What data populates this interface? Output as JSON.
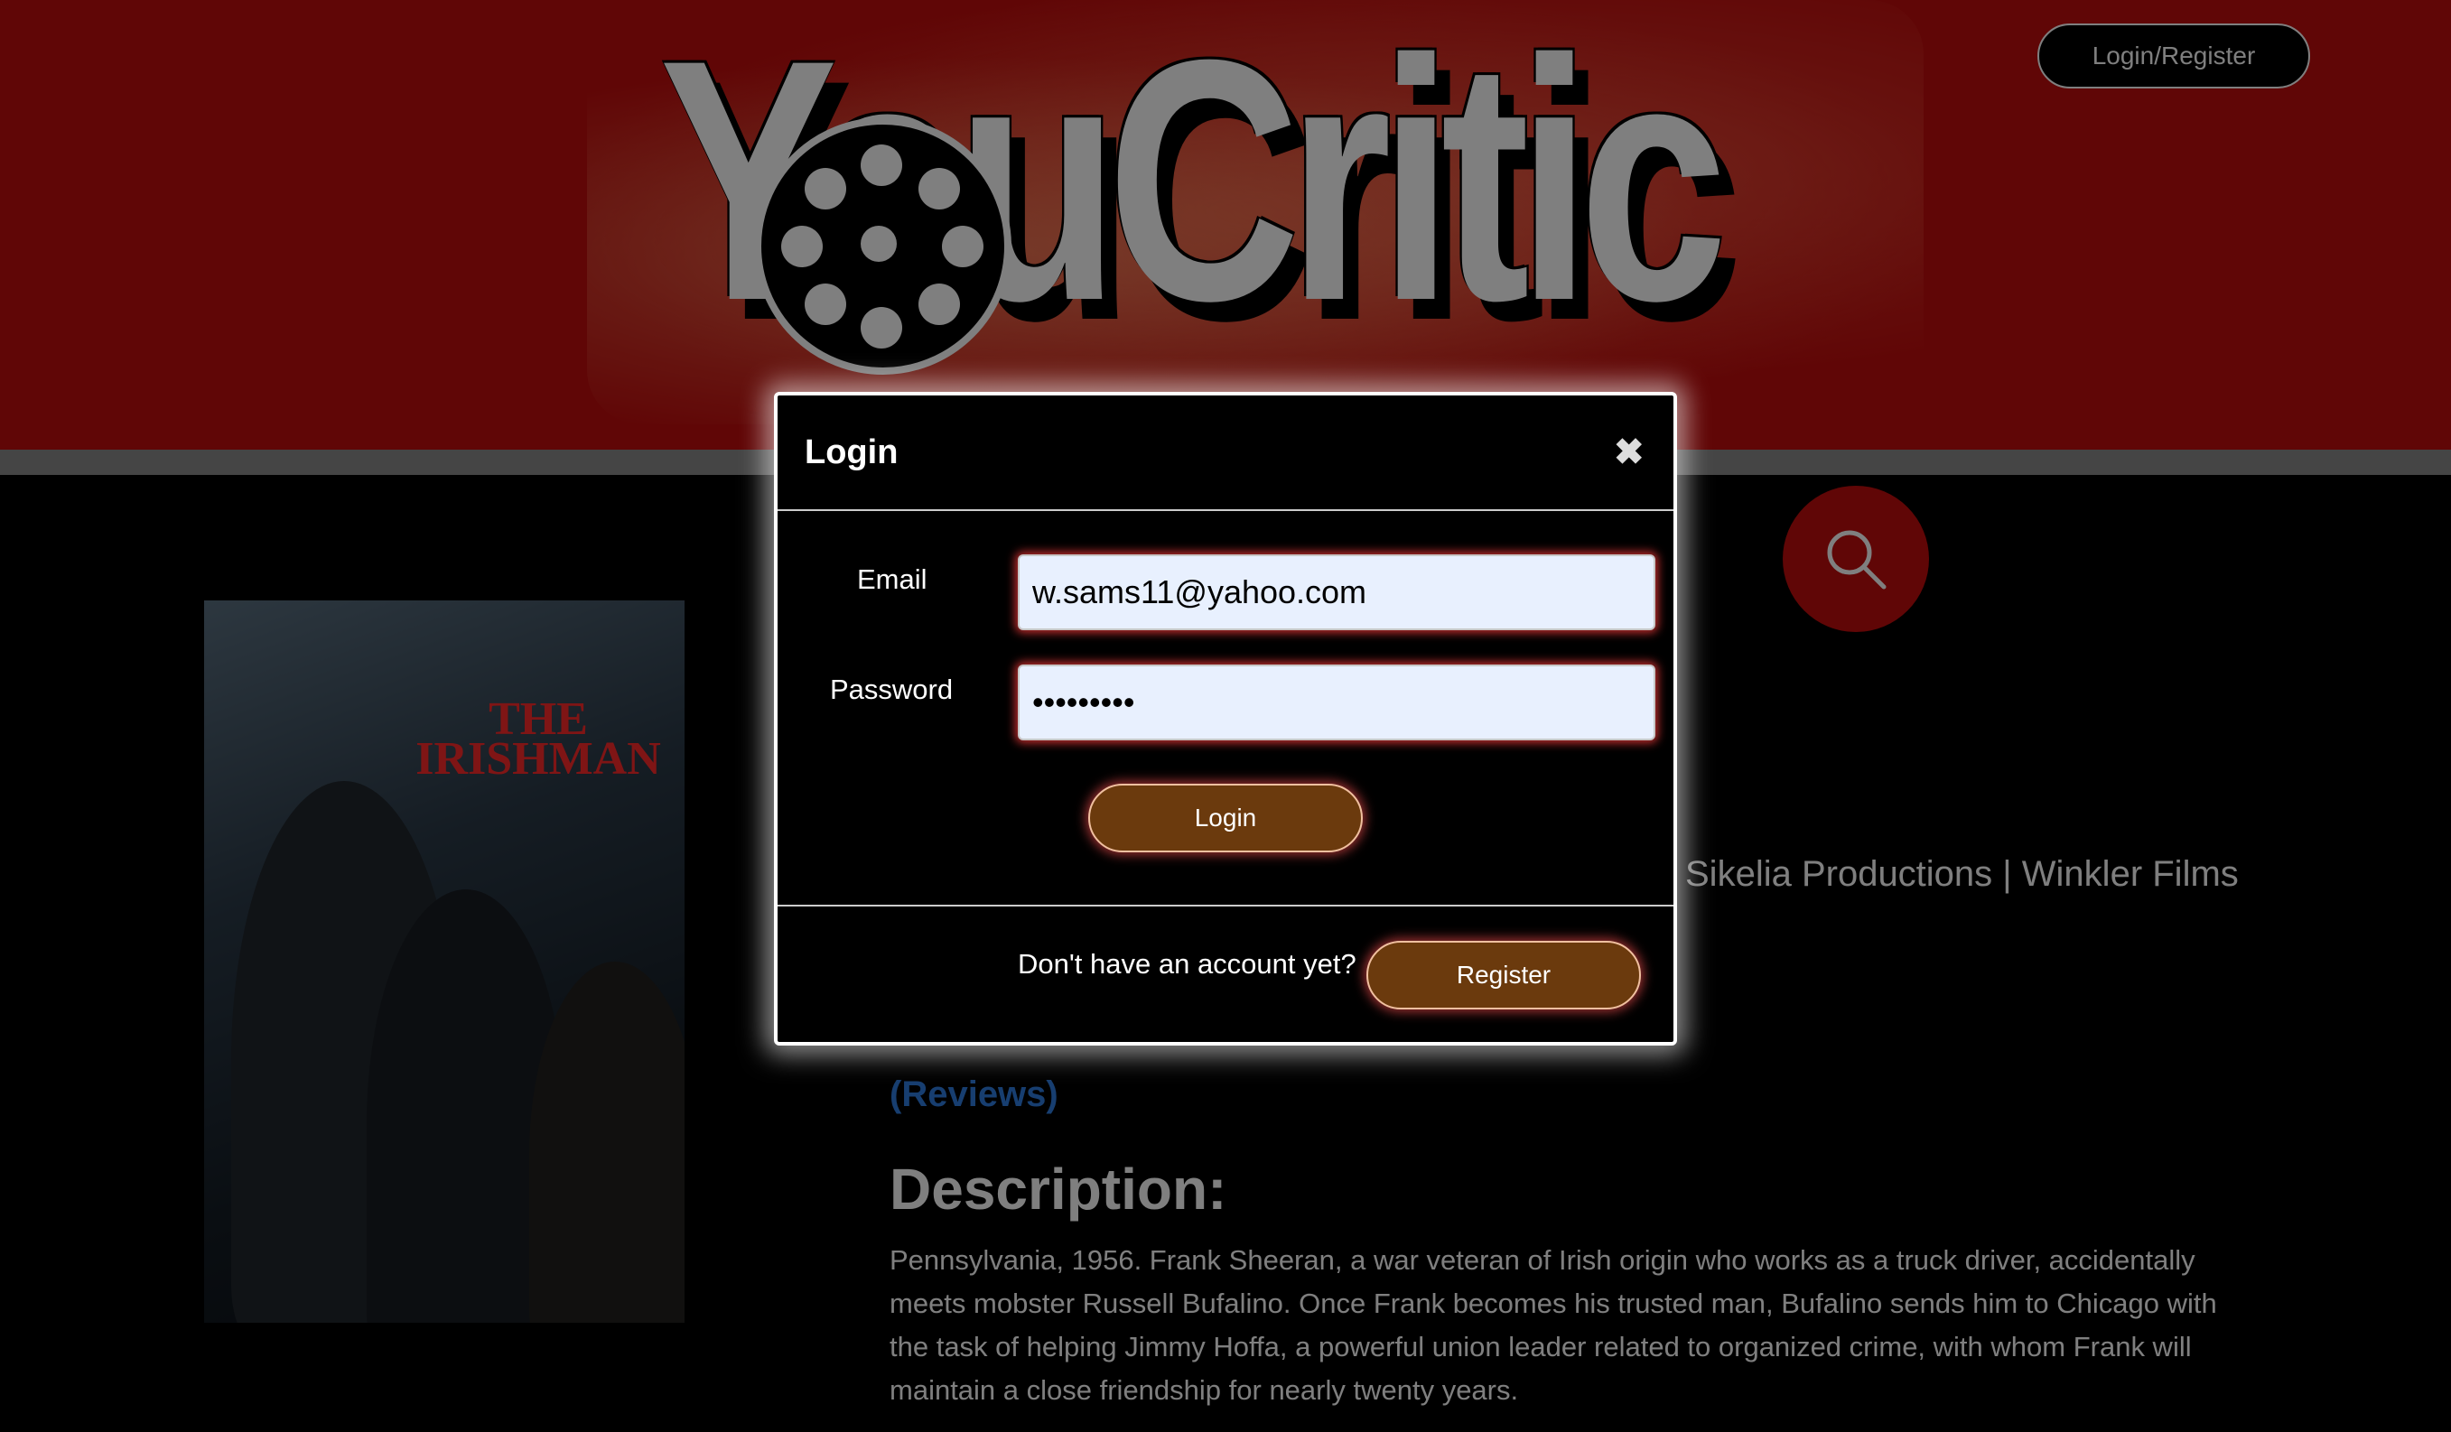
{
  "header": {
    "logo_text": "YouCritic",
    "login_register_label": "Login/Register"
  },
  "poster": {
    "title": "THE IRISHMAN"
  },
  "movie": {
    "production": "Sikelia Productions | Winkler Films",
    "reviews_link": "(Reviews)",
    "description_heading": "Description:",
    "description": "Pennsylvania, 1956. Frank Sheeran, a war veteran of Irish origin who works as a truck driver, accidentally meets mobster Russell Bufalino. Once Frank becomes his trusted man, Bufalino sends him to Chicago with the task of helping Jimmy Hoffa, a powerful union leader related to organized crime, with whom Frank will maintain a close friendship for nearly twenty years."
  },
  "modal": {
    "title": "Login",
    "close_glyph": "✖",
    "email_label": "Email",
    "email_value": "w.sams11@yahoo.com",
    "password_label": "Password",
    "password_value": "•••••••••",
    "login_button": "Login",
    "no_account_text": "Don't have an account yet?",
    "register_button": "Register"
  },
  "colors": {
    "header_red": "#c10d0d",
    "button_brown": "#6b3a0d",
    "link_blue": "#2f7de0"
  }
}
